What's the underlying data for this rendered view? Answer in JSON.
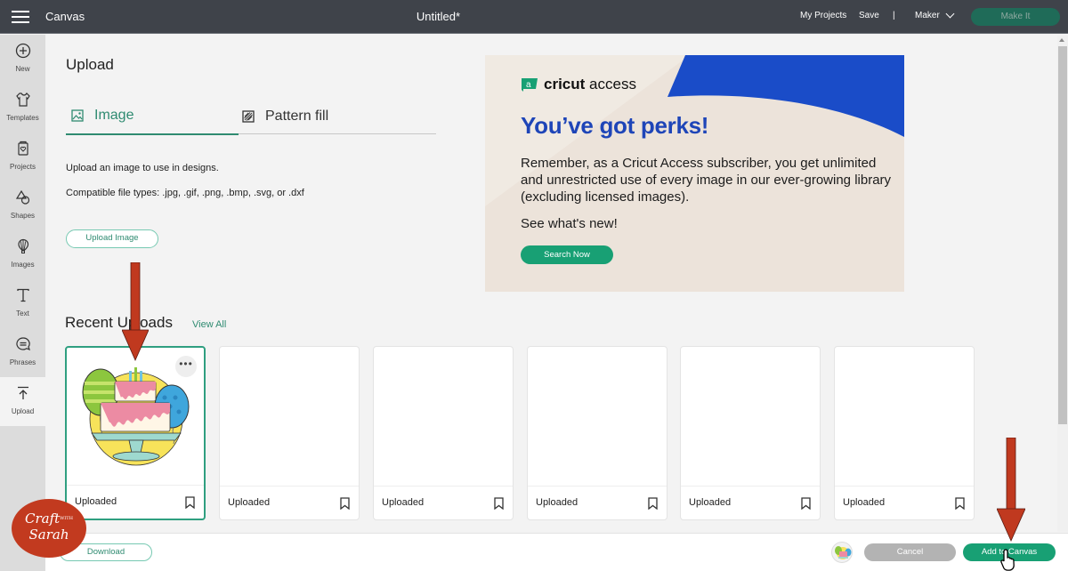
{
  "topbar": {
    "app_name": "Canvas",
    "document_title": "Untitled*",
    "my_projects": "My Projects",
    "save": "Save",
    "divider": "|",
    "machine": "Maker",
    "make_it": "Make It"
  },
  "sidebar": {
    "items": [
      {
        "label": "New",
        "icon": "plus-circle-icon"
      },
      {
        "label": "Templates",
        "icon": "shirt-icon"
      },
      {
        "label": "Projects",
        "icon": "projects-icon"
      },
      {
        "label": "Shapes",
        "icon": "shapes-icon"
      },
      {
        "label": "Images",
        "icon": "balloon-icon"
      },
      {
        "label": "Text",
        "icon": "text-icon"
      },
      {
        "label": "Phrases",
        "icon": "speech-bubble-icon"
      },
      {
        "label": "Upload",
        "icon": "upload-icon",
        "active": true
      }
    ]
  },
  "upload_panel": {
    "title": "Upload",
    "tabs": [
      {
        "label": "Image",
        "icon": "image-icon",
        "active": true
      },
      {
        "label": "Pattern fill",
        "icon": "pattern-icon",
        "active": false
      }
    ],
    "description": "Upload an image to use in designs.",
    "file_types": "Compatible file types: .jpg, .gif, .png, .bmp, .svg, or .dxf",
    "upload_button": "Upload Image"
  },
  "promo": {
    "logo_bold": "cricut",
    "logo_light": "access",
    "headline": "You’ve got perks!",
    "body": "Remember, as a Cricut Access subscriber, you get unlimited and unrestricted use of every image in our ever-growing library (excluding licensed images).",
    "cta_text": "See what's new!",
    "button": "Search Now",
    "colors": {
      "headline": "#1e45b8",
      "button": "#18a074",
      "background": "#ece3da",
      "accent": "#1a4cc8"
    }
  },
  "recent_uploads": {
    "title": "Recent Uploads",
    "view_all": "View All",
    "items": [
      {
        "caption": "Uploaded",
        "selected": true,
        "has_image": true,
        "image": "birthday-cake-with-balloons"
      },
      {
        "caption": "Uploaded",
        "selected": false,
        "has_image": false
      },
      {
        "caption": "Uploaded",
        "selected": false,
        "has_image": false
      },
      {
        "caption": "Uploaded",
        "selected": false,
        "has_image": false
      },
      {
        "caption": "Uploaded",
        "selected": false,
        "has_image": false
      },
      {
        "caption": "Uploaded",
        "selected": false,
        "has_image": false
      }
    ],
    "more_label": "•••"
  },
  "bottombar": {
    "download": "Download",
    "cancel": "Cancel",
    "add_to_canvas": "Add to Canvas"
  },
  "watermark": {
    "line1": "Craft",
    "with": "WITH",
    "line2": "Sarah"
  },
  "colors": {
    "topbar": "#3f434a",
    "accent_green": "#2f8b71",
    "annotation_arrow": "#c0391f"
  }
}
